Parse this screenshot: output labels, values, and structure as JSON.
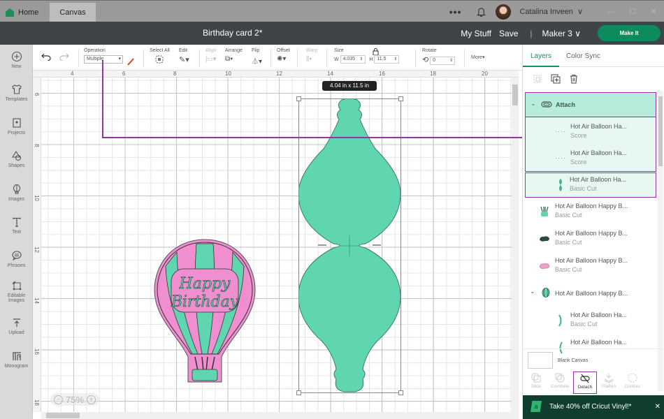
{
  "titlebar": {
    "tabs": [
      {
        "label": "Home",
        "icon": "home-icon"
      },
      {
        "label": "Canvas"
      }
    ],
    "more_label": "•••",
    "user_name": "Catalina Inveen",
    "window_controls": [
      "—",
      "☐",
      "✕"
    ]
  },
  "header": {
    "document_title": "Birthday card 2*",
    "my_stuff": "My Stuff",
    "save": "Save",
    "separator": "|",
    "machine": "Maker 3",
    "make_it": "Make It"
  },
  "sidebar": {
    "items": [
      {
        "label": "New",
        "icon": "plus-circle-icon"
      },
      {
        "label": "Templates",
        "icon": "shirt-icon"
      },
      {
        "label": "Projects",
        "icon": "projects-icon"
      },
      {
        "label": "Shapes",
        "icon": "shapes-icon"
      },
      {
        "label": "Images",
        "icon": "lightbulb-icon"
      },
      {
        "label": "Text",
        "icon": "text-icon"
      },
      {
        "label": "Phrases",
        "icon": "speech-bubble-icon"
      },
      {
        "label": "Editable Images",
        "icon": "editable-images-icon"
      },
      {
        "label": "Upload",
        "icon": "upload-icon"
      },
      {
        "label": "Monogram",
        "icon": "monogram-icon"
      }
    ]
  },
  "toolbar": {
    "operation_label": "Operation",
    "operation_value": "Multiple",
    "select_all": "Select All",
    "edit": "Edit",
    "align": "Align",
    "arrange": "Arrange",
    "flip": "Flip",
    "offset": "Offset",
    "warp": "Warp",
    "size_label": "Size",
    "width_label": "W",
    "width_value": "4.035",
    "height_label": "H",
    "height_value": "11.5",
    "rotate_label": "Rotate",
    "rotate_value": "0",
    "more": "More▾"
  },
  "canvas": {
    "ruler_top": [
      "4",
      "6",
      "8",
      "10",
      "12",
      "14",
      "16",
      "18",
      "20"
    ],
    "ruler_left": [
      "6",
      "8",
      "10",
      "12",
      "14",
      "16",
      "18"
    ],
    "dimension_tooltip": "4.04  in x 11.5  in",
    "zoom_level": "75%",
    "balloon_text": "Happy Birthday",
    "colors": {
      "mint": "#5fd6b0",
      "pink": "#ef8fcf",
      "selection": "#9b2fa8"
    }
  },
  "panel": {
    "tabs": [
      {
        "label": "Layers",
        "active": true
      },
      {
        "label": "Color Sync",
        "active": false
      }
    ],
    "layers": [
      {
        "name": "Attach",
        "type": "group",
        "expanded": true
      },
      {
        "name": "Hot Air Balloon Ha...",
        "op": "Score"
      },
      {
        "name": "Hot Air Balloon Ha...",
        "op": "Score"
      },
      {
        "name": "Hot Air Balloon Ha...",
        "op": "Basic Cut"
      },
      {
        "name": "Hot Air Balloon Happy B...",
        "op": "Basic Cut"
      },
      {
        "name": "Hot Air Balloon Happy B...",
        "op": "Basic Cut"
      },
      {
        "name": "Hot Air Balloon Happy B...",
        "op": "Basic Cut"
      },
      {
        "name": "Hot Air Balloon Happy B...",
        "type": "group",
        "expanded": true
      },
      {
        "name": "Hot Air Balloon Ha...",
        "op": "Basic Cut"
      },
      {
        "name": "Hot Air Balloon Ha...",
        "op": ""
      }
    ],
    "blank_canvas": "Blank Canvas",
    "ops": [
      {
        "label": "Slice",
        "enabled": false
      },
      {
        "label": "Combine",
        "enabled": false
      },
      {
        "label": "Detach",
        "enabled": true
      },
      {
        "label": "Flatten",
        "enabled": false
      },
      {
        "label": "Contour",
        "enabled": false
      }
    ],
    "promo": {
      "logo": "a",
      "text": "Take 40% off Cricut Vinyl!*",
      "close": "✕"
    }
  }
}
